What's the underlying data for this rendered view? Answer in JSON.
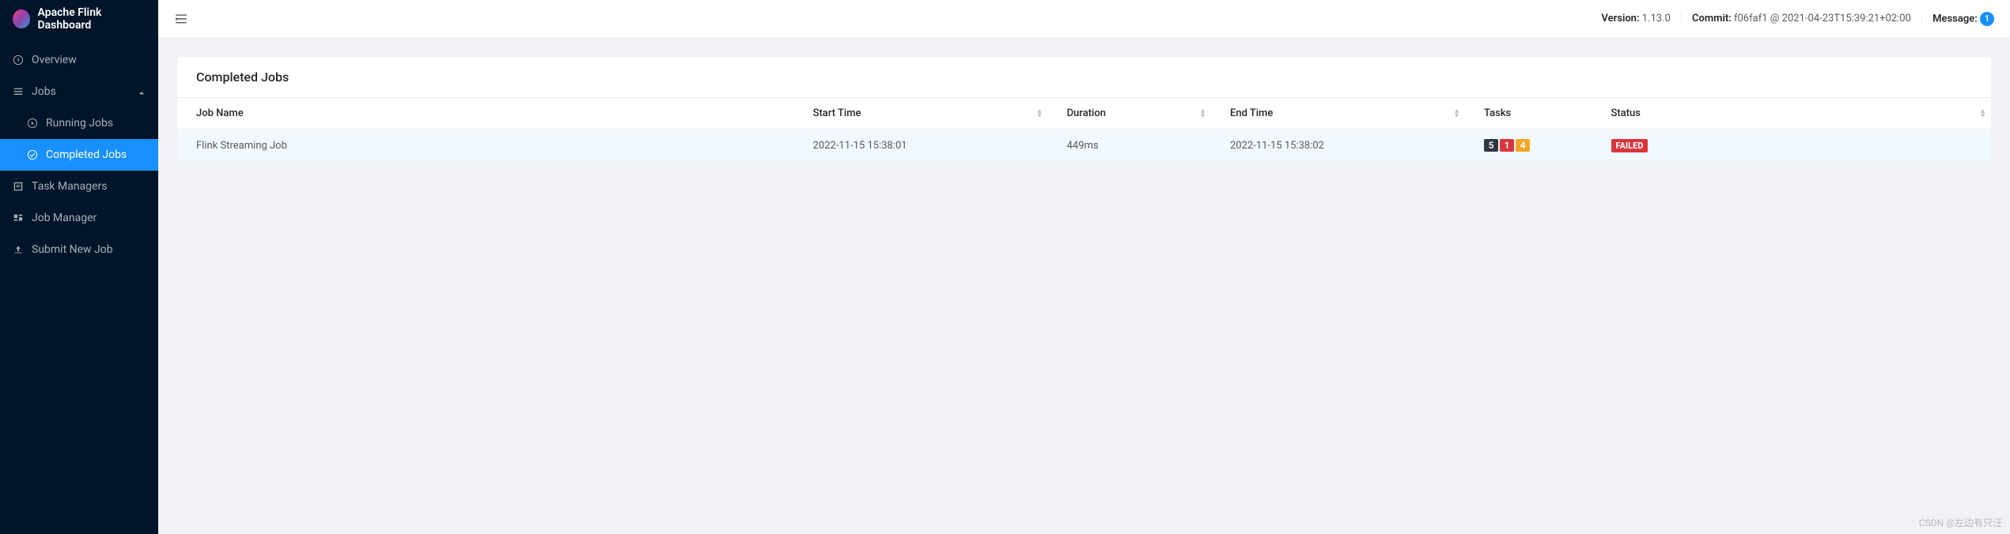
{
  "brand": {
    "title": "Apache Flink Dashboard"
  },
  "sidebar": {
    "items": [
      {
        "label": "Overview"
      },
      {
        "label": "Jobs"
      },
      {
        "label": "Task Managers"
      },
      {
        "label": "Job Manager"
      },
      {
        "label": "Submit New Job"
      }
    ],
    "jobs_submenu": [
      {
        "label": "Running Jobs"
      },
      {
        "label": "Completed Jobs"
      }
    ]
  },
  "topbar": {
    "version_label": "Version:",
    "version_value": "1.13.0",
    "commit_label": "Commit:",
    "commit_value": "f06faf1 @ 2021-04-23T15:39:21+02:00",
    "message_label": "Message:",
    "message_count": "1"
  },
  "card": {
    "title": "Completed Jobs"
  },
  "table": {
    "headers": {
      "job_name": "Job Name",
      "start_time": "Start Time",
      "duration": "Duration",
      "end_time": "End Time",
      "tasks": "Tasks",
      "status": "Status"
    },
    "rows": [
      {
        "job_name": "Flink Streaming Job",
        "start_time": "2022-11-15 15:38:01",
        "duration": "449ms",
        "end_time": "2022-11-15 15:38:02",
        "tasks": {
          "a": "5",
          "b": "1",
          "c": "4"
        },
        "status": "FAILED"
      }
    ]
  },
  "watermark": "CSDN @左边有只汪"
}
